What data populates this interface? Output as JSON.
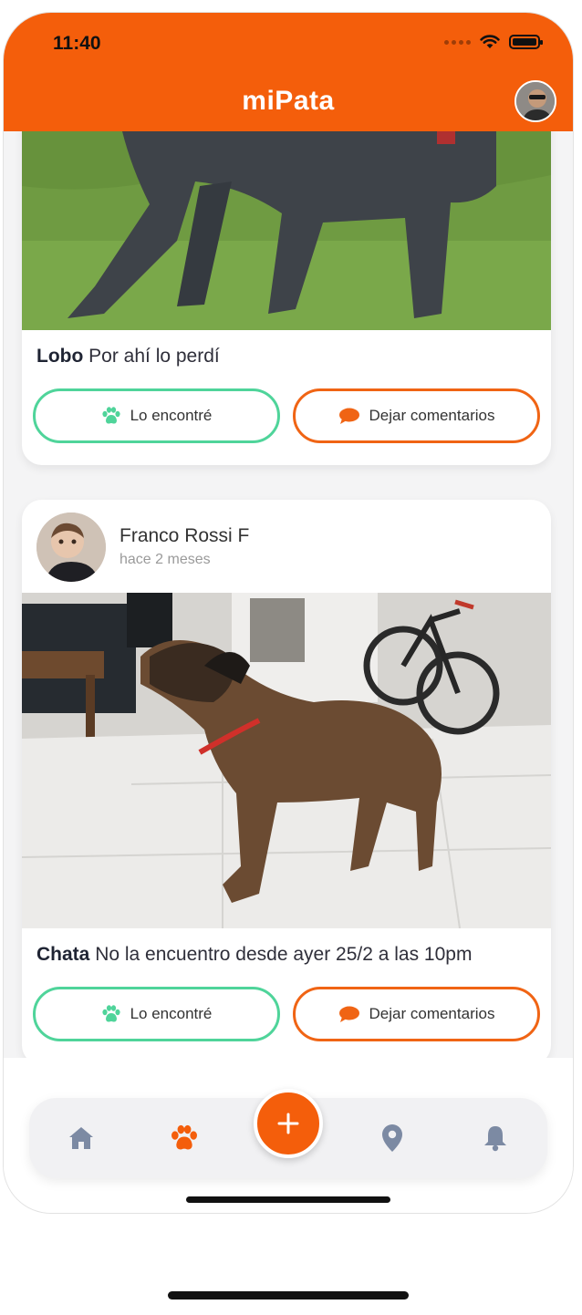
{
  "status_bar": {
    "time": "11:40"
  },
  "header": {
    "title": "miPata"
  },
  "posts": [
    {
      "pet_name": "Lobo",
      "message": "Por ahí lo perdí",
      "found_label": "Lo encontré",
      "comment_label": "Dejar comentarios"
    },
    {
      "author": "Franco Rossi F",
      "time_ago": "hace 2 meses",
      "pet_name": "Chata",
      "message": "No la encuentro desde ayer 25/2 a las 10pm",
      "found_label": "Lo encontré",
      "comment_label": "Dejar comentarios"
    }
  ],
  "nav": {
    "items": [
      "home-icon",
      "paw-icon",
      "plus-icon",
      "location-icon",
      "bell-icon"
    ],
    "active": "paw-icon"
  },
  "colors": {
    "brand": "#f45e0b",
    "found": "#4fd49a",
    "comment": "#f06414",
    "nav_icon": "#7c8aa3"
  }
}
